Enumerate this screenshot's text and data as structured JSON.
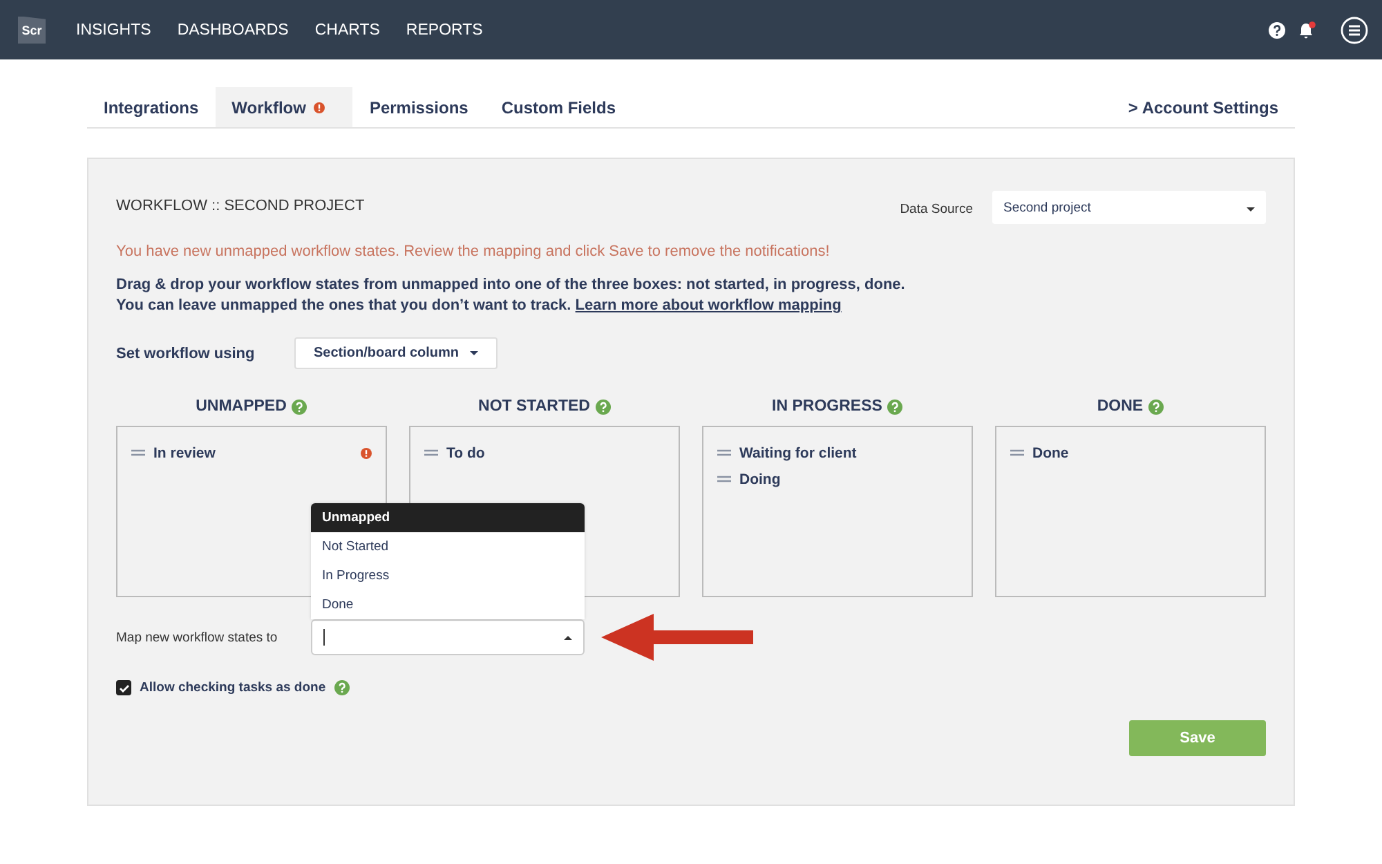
{
  "topbar": {
    "logo": "Scr",
    "nav": [
      "INSIGHTS",
      "DASHBOARDS",
      "CHARTS",
      "REPORTS"
    ],
    "notification_unread": true
  },
  "tabs": [
    {
      "label": "Integrations",
      "selected": false,
      "alert": false
    },
    {
      "label": "Workflow",
      "selected": true,
      "alert": true
    },
    {
      "label": "Permissions",
      "selected": false,
      "alert": false
    },
    {
      "label": "Custom Fields",
      "selected": false,
      "alert": false
    }
  ],
  "account_link": "> Account Settings",
  "panel": {
    "title": "WORKFLOW :: SECOND PROJECT",
    "data_source": {
      "label": "Data Source",
      "value": "Second project"
    },
    "warning": "You have new unmapped workflow states. Review the mapping and click Save to remove the notifications!",
    "instructions": [
      "Drag & drop your workflow states from unmapped into one of the three boxes: not started, in progress, done.",
      "You can leave unmapped the ones that you don’t want to track."
    ],
    "learn_more_link": "Learn more about workflow mapping",
    "set_workflow": {
      "label": "Set workflow using",
      "value": "Section/board column"
    },
    "columns": [
      {
        "title": "UNMAPPED",
        "items": [
          {
            "label": "In review",
            "alert": true
          }
        ]
      },
      {
        "title": "NOT STARTED",
        "items": [
          {
            "label": "To do",
            "alert": false
          }
        ]
      },
      {
        "title": "IN PROGRESS",
        "items": [
          {
            "label": "Waiting for client",
            "alert": false
          },
          {
            "label": "Doing",
            "alert": false
          }
        ]
      },
      {
        "title": "DONE",
        "items": [
          {
            "label": "Done",
            "alert": false
          }
        ]
      }
    ],
    "map_new": {
      "label": "Map new workflow states to",
      "expanded": true,
      "options": [
        {
          "label": "Unmapped",
          "selected": true
        },
        {
          "label": "Not Started",
          "selected": false
        },
        {
          "label": "In Progress",
          "selected": false
        },
        {
          "label": "Done",
          "selected": false
        }
      ]
    },
    "allow_checking": {
      "label": "Allow checking tasks as done",
      "checked": true
    },
    "save_button": "Save"
  }
}
